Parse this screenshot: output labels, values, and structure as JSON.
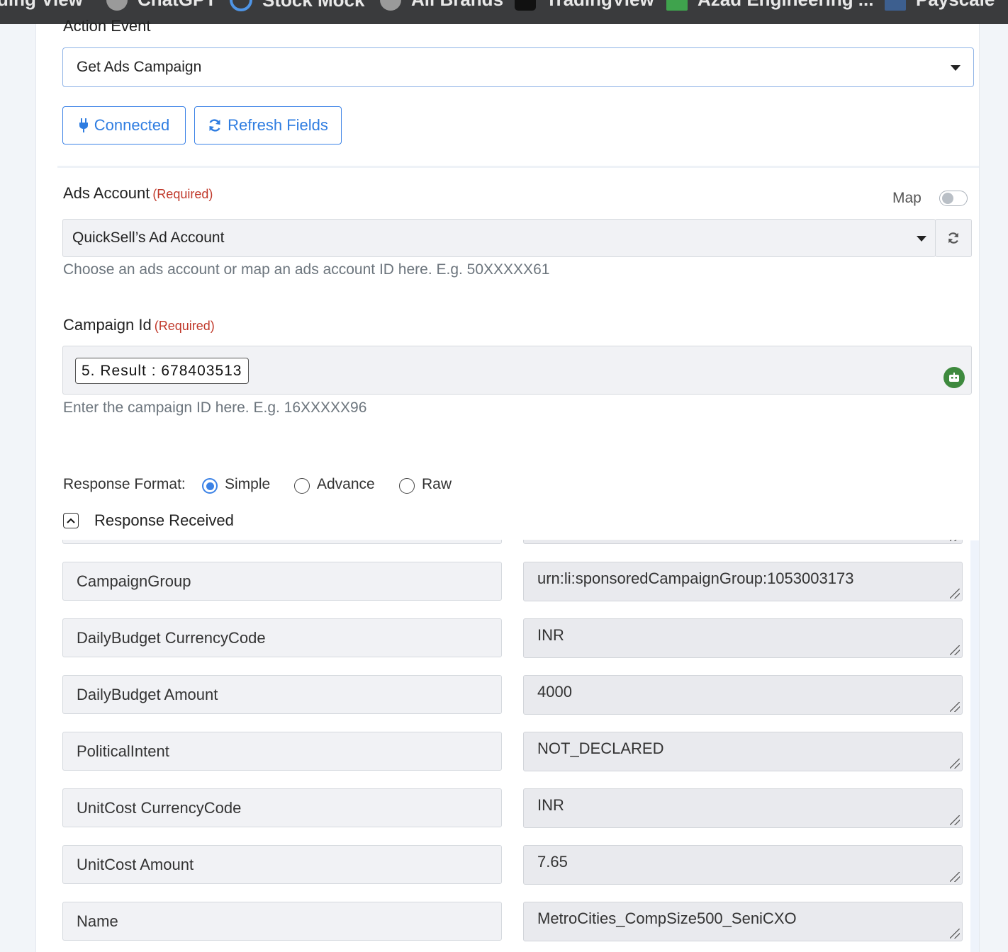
{
  "bookmarks": [
    {
      "label": "ding View",
      "icon": "bookmark-icon"
    },
    {
      "label": "ChatGPT",
      "icon": "chatgpt-icon"
    },
    {
      "label": "Stock Mock",
      "icon": "stockmock-icon"
    },
    {
      "label": "All Brands",
      "icon": "brands-icon"
    },
    {
      "label": "TradingView",
      "icon": "tradingview-icon"
    },
    {
      "label": "Azad Engineering ...",
      "icon": "chart-icon"
    },
    {
      "label": "Payscale",
      "icon": "payscale-icon"
    }
  ],
  "action_event": {
    "label": "Action Event",
    "selected": "Get Ads Campaign"
  },
  "buttons": {
    "connected": "Connected",
    "refresh": "Refresh Fields"
  },
  "ads_account": {
    "label": "Ads Account",
    "required": "(Required)",
    "map_label": "Map",
    "map_on": false,
    "selected": "QuickSell’s Ad Account",
    "help": "Choose an ads account or map an ads account ID here. E.g. 50XXXXX61"
  },
  "campaign_id": {
    "label": "Campaign Id",
    "required": "(Required)",
    "chip": "5. Result : 678403513",
    "help": "Enter the campaign ID here. E.g. 16XXXXX96"
  },
  "response_format": {
    "label": "Response Format:",
    "options": [
      "Simple",
      "Advance",
      "Raw"
    ],
    "selected": "Simple"
  },
  "response_received": {
    "label": "Response Received",
    "rows": [
      {
        "key": "CampaignGroup",
        "value": "urn:li:sponsoredCampaignGroup:1053003173"
      },
      {
        "key": "DailyBudget CurrencyCode",
        "value": "INR"
      },
      {
        "key": "DailyBudget Amount",
        "value": "4000"
      },
      {
        "key": "PoliticalIntent",
        "value": "NOT_DECLARED"
      },
      {
        "key": "UnitCost CurrencyCode",
        "value": "INR"
      },
      {
        "key": "UnitCost Amount",
        "value": "7.65"
      },
      {
        "key": "Name",
        "value": "MetroCities_CompSize500_SeniCXO"
      }
    ]
  },
  "colors": {
    "accent": "#3b82e6",
    "required": "#c0392b",
    "bookmark_bar": "#3a3b3d"
  }
}
